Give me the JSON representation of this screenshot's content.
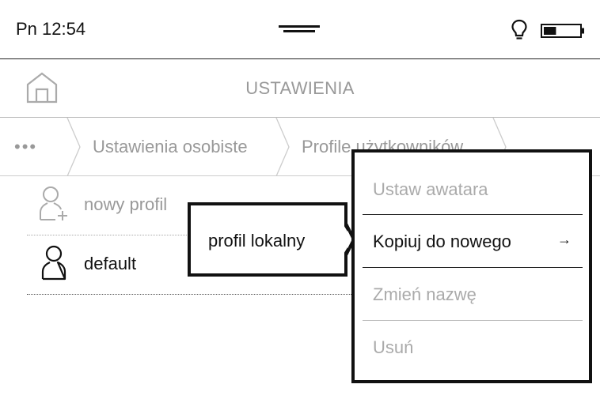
{
  "status_bar": {
    "time": "Pn 12:54",
    "battery_level": 0.35
  },
  "header": {
    "title": "USTAWIENIA"
  },
  "breadcrumb": {
    "overflow": "•••",
    "items": [
      "Ustawienia osobiste",
      "Profile użytkowników"
    ]
  },
  "list": {
    "items": [
      {
        "label": "nowy profil",
        "icon": "add-user-icon",
        "enabled": false
      },
      {
        "label": "default",
        "icon": "user-icon",
        "enabled": true
      }
    ]
  },
  "submenu": {
    "label": "profil lokalny"
  },
  "context_menu": {
    "items": [
      {
        "label": "Ustaw awatara",
        "enabled": false
      },
      {
        "label": "Kopiuj do nowego",
        "enabled": true,
        "arrow": "→"
      },
      {
        "label": "Zmień nazwę",
        "enabled": false
      },
      {
        "label": "Usuń",
        "enabled": false
      }
    ]
  },
  "colors": {
    "text": "#111111",
    "disabled_text": "#999999",
    "border": "#111111"
  }
}
